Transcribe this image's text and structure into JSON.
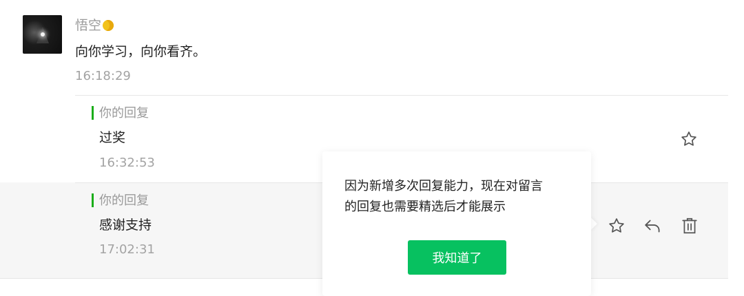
{
  "comment": {
    "nickname": "悟空",
    "badge_icon": "moon-icon",
    "text": "向你学习，向你看齐。",
    "time": "16:18:29"
  },
  "replies": [
    {
      "label": "你的回复",
      "text": "过奖",
      "time": "16:32:53",
      "actions": [
        "star-icon"
      ]
    },
    {
      "label": "你的回复",
      "text": "感谢支持",
      "time": "17:02:31",
      "actions": [
        "star-icon",
        "reply-icon",
        "trash-icon"
      ]
    }
  ],
  "popover": {
    "message_line1": "因为新增多次回复能力，现在对留言",
    "message_line2": "的回复也需要精选后才能展示",
    "button_label": "我知道了"
  },
  "colors": {
    "accent_green": "#07c160",
    "reply_bar_green": "#1aad19",
    "hover_row_bg": "#f6f6f6"
  }
}
